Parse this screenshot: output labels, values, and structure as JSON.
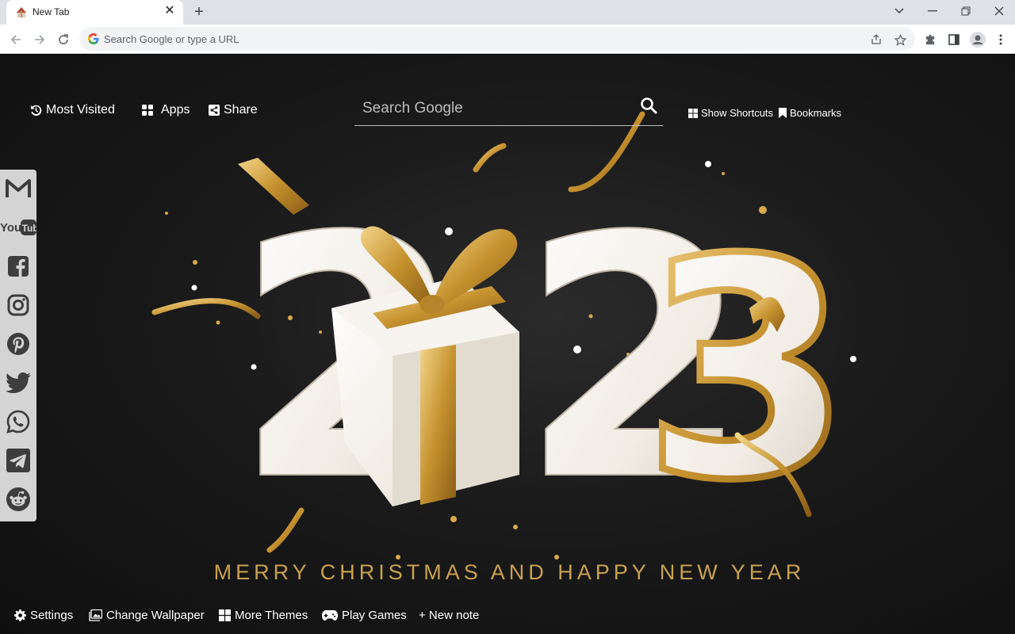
{
  "browser": {
    "tab_title": "New Tab",
    "address_placeholder": "Search Google or type a URL"
  },
  "ntp": {
    "top_links": {
      "most_visited": "Most Visited",
      "apps": "Apps",
      "share": "Share"
    },
    "search_placeholder": "Search Google",
    "right_links": {
      "show_shortcuts": "Show Shortcuts",
      "bookmarks": "Bookmarks"
    },
    "social_icons": [
      "gmail-icon",
      "youtube-icon",
      "facebook-icon",
      "instagram-icon",
      "pinterest-icon",
      "twitter-icon",
      "whatsapp-icon",
      "telegram-icon",
      "reddit-icon"
    ],
    "wallpaper": {
      "year_digits": [
        "2",
        "2",
        "3"
      ],
      "greeting": "MERRY CHRISTMAS AND HAPPY NEW YEAR"
    },
    "bottom_links": {
      "settings": "Settings",
      "change_wallpaper": "Change Wallpaper",
      "more_themes": "More Themes",
      "play_games": "Play Games",
      "new_note": "+ New note"
    }
  },
  "colors": {
    "gold": "#c9a14e",
    "background": "#141414",
    "social_bar": "#d4d4d4"
  }
}
